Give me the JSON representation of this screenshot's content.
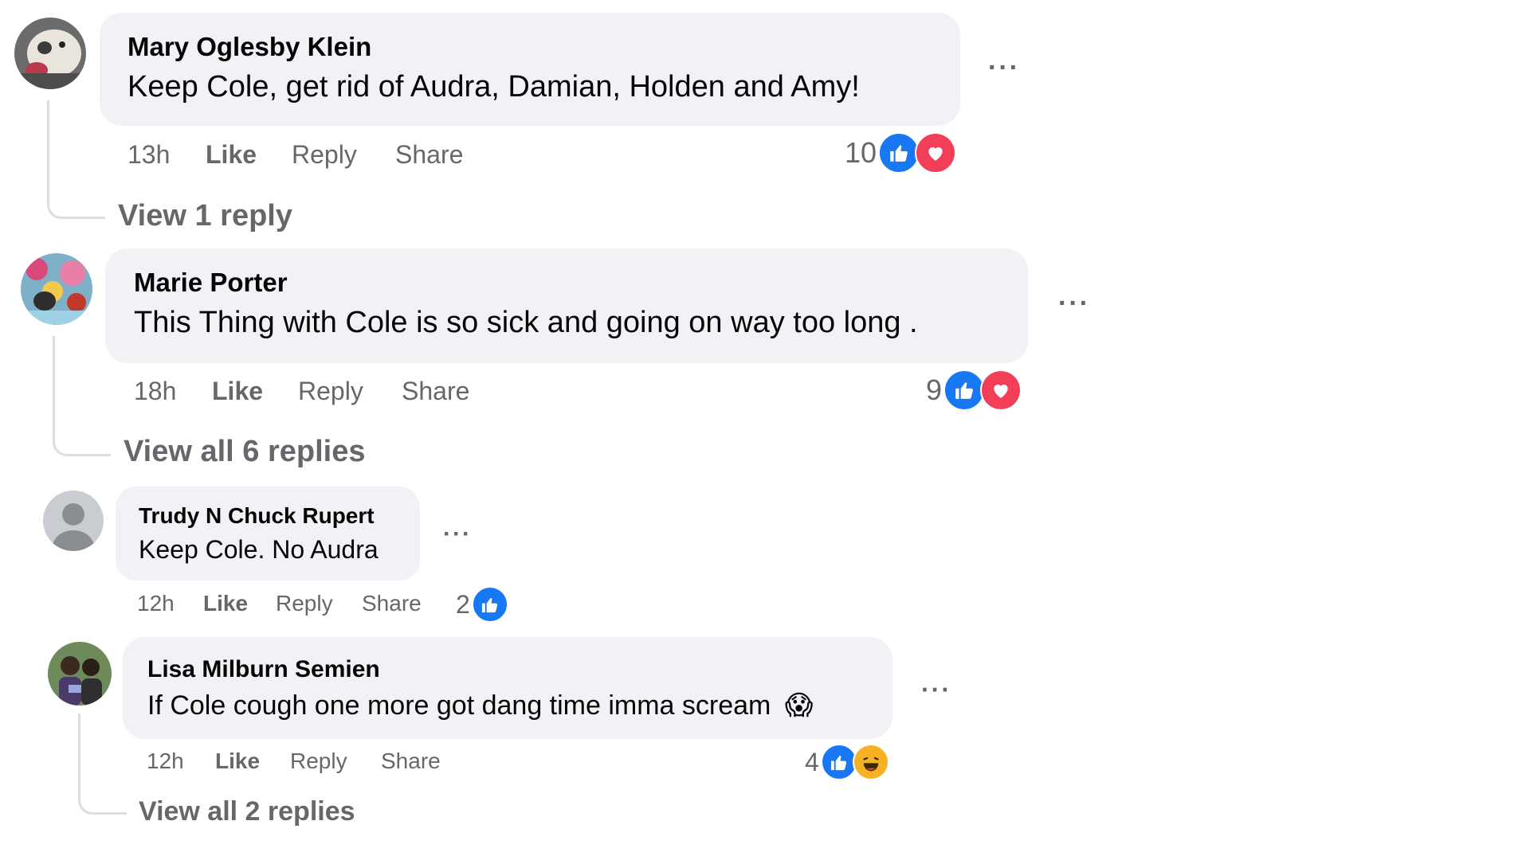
{
  "comments": [
    {
      "author": "Mary Oglesby Klein",
      "text": "Keep Cole, get rid of Audra, Damian, Holden and Amy!",
      "time": "13h",
      "like": "Like",
      "reply": "Reply",
      "share": "Share",
      "reaction_count": "10",
      "reactions": [
        "like-icon",
        "love-icon"
      ],
      "view_replies": "View 1 reply"
    },
    {
      "author": "Marie Porter",
      "text": "This Thing with Cole is so sick and going on way too long .",
      "time": "18h",
      "like": "Like",
      "reply": "Reply",
      "share": "Share",
      "reaction_count": "9",
      "reactions": [
        "like-icon",
        "love-icon"
      ],
      "view_replies": "View all 6 replies"
    },
    {
      "author": "Trudy N Chuck Rupert",
      "text": "Keep Cole. No Audra",
      "time": "12h",
      "like": "Like",
      "reply": "Reply",
      "share": "Share",
      "reaction_count": "2",
      "reactions": [
        "like-icon"
      ]
    },
    {
      "author": "Lisa Milburn Semien",
      "text": "If Cole cough one more got dang time imma scream",
      "emoji": "😱",
      "time": "12h",
      "like": "Like",
      "reply": "Reply",
      "share": "Share",
      "reaction_count": "4",
      "reactions": [
        "like-icon",
        "haha-icon"
      ],
      "view_replies": "View all 2 replies"
    }
  ],
  "more_label": "···",
  "colors": {
    "bubble": "#f0f2f5",
    "secondary_text": "#65676b",
    "like_blue": "#1877f2",
    "love_red": "#f33e58",
    "haha_yellow": "#f7b125"
  }
}
